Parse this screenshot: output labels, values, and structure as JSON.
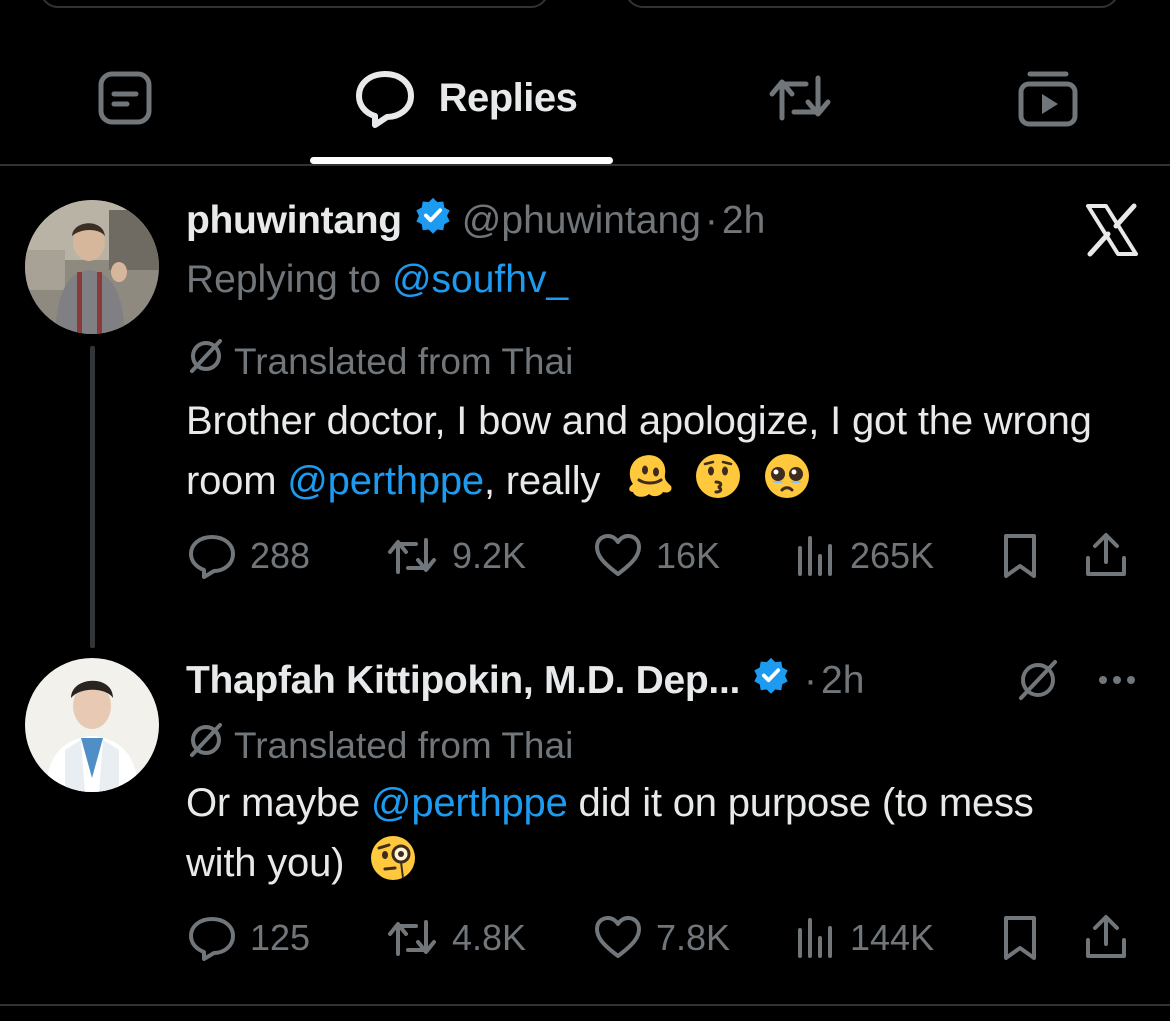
{
  "tabs": {
    "posts_icon": "article-icon",
    "replies_label": "Replies",
    "reposts_icon": "repost-icon",
    "media_icon": "media-icon",
    "active": "Replies"
  },
  "colors": {
    "background": "#000000",
    "text": "#e7e9ea",
    "muted": "#71767b",
    "link": "#1d9bf0",
    "verified": "#1d9bf0",
    "divider": "#2f3336"
  },
  "tweets": [
    {
      "name": "phuwintang",
      "verified": true,
      "handle": "@phuwintang",
      "separator": "·",
      "time": "2h",
      "replying_prefix": "Replying to ",
      "replying_to": "@soufhv_",
      "translated": "Translated from Thai",
      "text_before": "Brother doctor, I bow and apologize, I got the wrong room ",
      "mention": "@perthppe",
      "text_after": ", really",
      "emojis": [
        "melting-face",
        "kissing-face",
        "pleading-face"
      ],
      "replies": "288",
      "reposts": "9.2K",
      "likes": "16K",
      "views": "265K"
    },
    {
      "name": "Thapfah Kittipokin, M.D. Dep...",
      "verified": true,
      "separator": "·",
      "time": "2h",
      "translated": "Translated from Thai",
      "text_before": "Or maybe ",
      "mention": "@perthppe",
      "text_after": " did it on purpose (to mess with you)",
      "emojis": [
        "face-with-monocle"
      ],
      "replies": "125",
      "reposts": "4.8K",
      "likes": "7.8K",
      "views": "144K"
    }
  ]
}
